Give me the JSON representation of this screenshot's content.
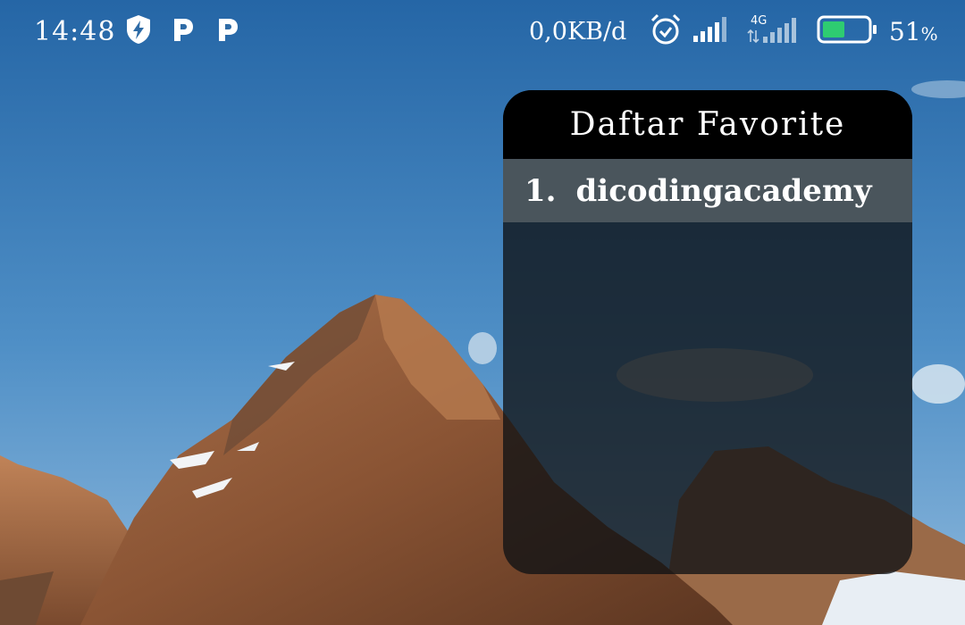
{
  "status_bar": {
    "time": "14:48",
    "net_speed": "0,0KB/d",
    "network_type": "4G",
    "battery_percent": "51",
    "battery_unit": "%",
    "battery_level": 0.51,
    "icons": [
      "shield-bolt-icon",
      "p-notification-icon",
      "p-notification-icon",
      "alarm-icon",
      "signal-icon",
      "signal-4g-icon",
      "battery-icon"
    ]
  },
  "widget": {
    "title": "Daftar Favorite",
    "items": [
      {
        "number": "1.",
        "label": "dicodingacademy"
      }
    ]
  },
  "colors": {
    "sky_top": "#2b6aa8",
    "sky_bottom": "#6fa4cf",
    "widget_header": "#000000",
    "widget_item": "#4a555c",
    "battery_fill": "#2ecc71"
  }
}
